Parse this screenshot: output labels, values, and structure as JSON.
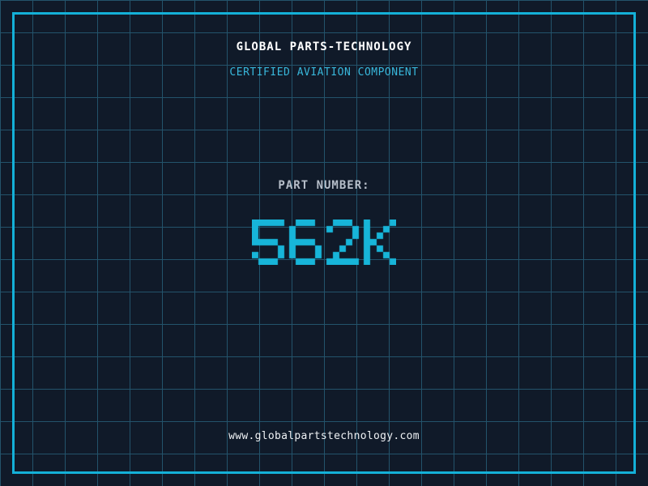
{
  "header": {
    "title": "GLOBAL PARTS-TECHNOLOGY",
    "subtitle": "CERTIFIED AVIATION COMPONENT"
  },
  "part": {
    "label": "PART NUMBER:",
    "value": "562K"
  },
  "footer": {
    "url": "www.globalpartstechnology.com"
  },
  "colors": {
    "background": "#101a29",
    "grid_line": "#23536b",
    "border_accent": "#14b0d8",
    "title_text": "#ffffff",
    "subtitle_text": "#38b7db",
    "label_text": "#b6bec9",
    "part_number_text": "#17b5d9",
    "url_text": "#eef1f4"
  }
}
